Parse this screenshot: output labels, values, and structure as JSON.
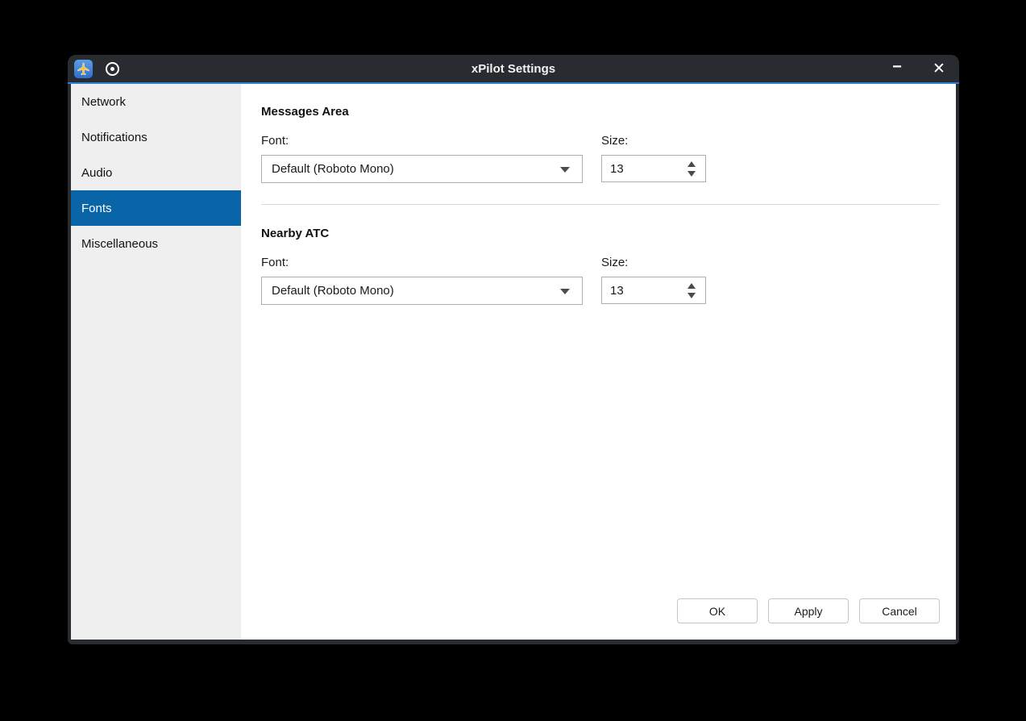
{
  "window": {
    "title": "xPilot Settings",
    "minimize_glyph": "−",
    "close_glyph": "✕"
  },
  "sidebar": {
    "items": [
      {
        "label": "Network",
        "selected": false
      },
      {
        "label": "Notifications",
        "selected": false
      },
      {
        "label": "Audio",
        "selected": false
      },
      {
        "label": "Fonts",
        "selected": true
      },
      {
        "label": "Miscellaneous",
        "selected": false
      }
    ]
  },
  "sections": [
    {
      "title": "Messages Area",
      "font_label": "Font:",
      "font_value": "Default (Roboto Mono)",
      "size_label": "Size:",
      "size_value": "13"
    },
    {
      "title": "Nearby ATC",
      "font_label": "Font:",
      "font_value": "Default (Roboto Mono)",
      "size_label": "Size:",
      "size_value": "13"
    }
  ],
  "footer": {
    "ok_label": "OK",
    "apply_label": "Apply",
    "cancel_label": "Cancel"
  },
  "icons": {
    "titlebar": [
      "airplane-icon",
      "record-icon"
    ]
  },
  "colors": {
    "titlebar_bg": "#282b30",
    "accent_line": "#2e7dd2",
    "selection_blue": "#0a64a8",
    "sidebar_bg": "#efefef"
  }
}
